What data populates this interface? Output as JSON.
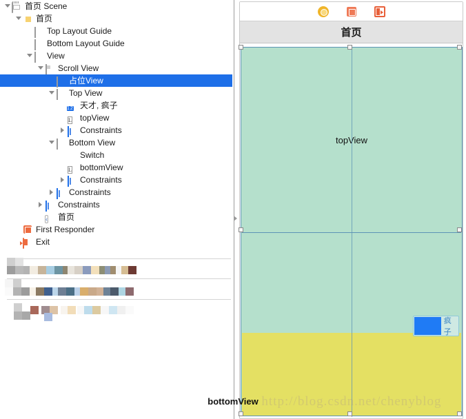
{
  "outline": {
    "rows": [
      {
        "label": "首页 Scene",
        "indent": 0,
        "twisty": "open",
        "icon": "scene-icon",
        "selected": false
      },
      {
        "label": "首页",
        "indent": 1,
        "twisty": "open",
        "icon": "view-controller-icon",
        "selected": false
      },
      {
        "label": "Top Layout Guide",
        "indent": 2,
        "twisty": "none",
        "icon": "top-layout-guide-icon",
        "selected": false
      },
      {
        "label": "Bottom Layout Guide",
        "indent": 2,
        "twisty": "none",
        "icon": "bottom-layout-guide-icon",
        "selected": false
      },
      {
        "label": "View",
        "indent": 2,
        "twisty": "open",
        "icon": "view-icon",
        "selected": false
      },
      {
        "label": "Scroll View",
        "indent": 3,
        "twisty": "open",
        "icon": "scroll-view-icon",
        "selected": false
      },
      {
        "label": "占位View",
        "indent": 4,
        "twisty": "none",
        "icon": "view-icon",
        "selected": true
      },
      {
        "label": "Top View",
        "indent": 4,
        "twisty": "open",
        "icon": "view-icon",
        "selected": false
      },
      {
        "label": "天才, 疯子",
        "indent": 5,
        "twisty": "none",
        "icon": "segmented-control-icon",
        "selected": false
      },
      {
        "label": "topView",
        "indent": 5,
        "twisty": "none",
        "icon": "label-icon",
        "selected": false
      },
      {
        "label": "Constraints",
        "indent": 5,
        "twisty": "closed",
        "icon": "constraints-icon",
        "selected": false
      },
      {
        "label": "Bottom View",
        "indent": 4,
        "twisty": "open",
        "icon": "view-icon",
        "selected": false
      },
      {
        "label": "Switch",
        "indent": 5,
        "twisty": "none",
        "icon": "switch-icon",
        "selected": false
      },
      {
        "label": "bottomView",
        "indent": 5,
        "twisty": "none",
        "icon": "label-icon",
        "selected": false
      },
      {
        "label": "Constraints",
        "indent": 5,
        "twisty": "closed",
        "icon": "constraints-icon",
        "selected": false
      },
      {
        "label": "Constraints",
        "indent": 4,
        "twisty": "closed",
        "icon": "constraints-icon",
        "selected": false
      },
      {
        "label": "Constraints",
        "indent": 3,
        "twisty": "closed",
        "icon": "constraints-icon",
        "selected": false
      },
      {
        "label": "首页",
        "indent": 3,
        "twisty": "none",
        "icon": "back-bar-button-icon",
        "selected": false
      },
      {
        "label": "First Responder",
        "indent": 1,
        "twisty": "none",
        "icon": "first-responder-icon",
        "selected": false
      },
      {
        "label": "Exit",
        "indent": 1,
        "twisty": "none",
        "icon": "exit-icon",
        "selected": false
      }
    ]
  },
  "canvas": {
    "dock": {
      "items": [
        {
          "icon": "view-controller-dock-icon"
        },
        {
          "icon": "first-responder-dock-icon"
        },
        {
          "icon": "exit-dock-icon"
        }
      ]
    },
    "navbar": {
      "title": "首页"
    },
    "top_view_label": "topView",
    "bottom_view_label": "bottomView",
    "switch_label": "疯子"
  },
  "watermark": "http://blog.csdn.net/chenyblog",
  "colors": {
    "selection_blue": "#1e6fe8",
    "top_view_green": "#b5e0cc",
    "bottom_view_yellow": "#e4e063",
    "outline_border": "#5c93b5",
    "switch_blue": "#1f7bf5",
    "navbar_gray": "#e3e3e3",
    "accent_orange": "#ed6b3f",
    "guide_blue": "#3f7fd0"
  }
}
